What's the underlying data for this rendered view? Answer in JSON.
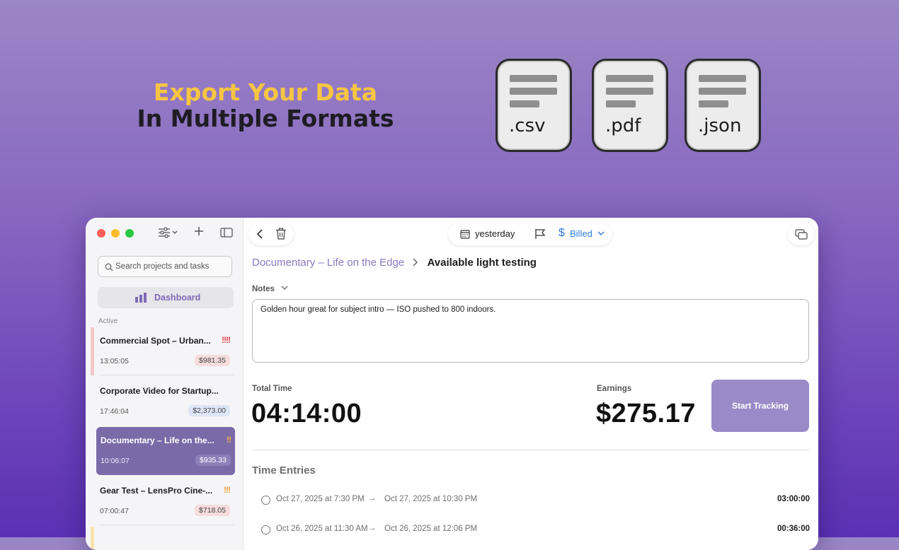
{
  "hero": {
    "line1": "Export Your Data",
    "line2": "In Multiple Formats"
  },
  "files": [
    {
      "ext": ".csv"
    },
    {
      "ext": ".pdf"
    },
    {
      "ext": ".json"
    }
  ],
  "sidebar": {
    "search_placeholder": "Search projects and tasks",
    "dashboard_label": "Dashboard",
    "section_label": "Active",
    "projects": [
      {
        "title": "Commercial Spot – Urban...",
        "priority": "!!!!",
        "time": "13:05:05",
        "amount": "$981.35"
      },
      {
        "title": "Corporate Video for Startup...",
        "priority": "",
        "time": "17:46:04",
        "amount": "$2,373.00"
      },
      {
        "title": "Documentary – Life on the...",
        "priority": "!!",
        "time": "10:06:07",
        "amount": "$935.33"
      },
      {
        "title": "Gear Test – LensPro Cine-...",
        "priority": "!!!",
        "time": "07:00:47",
        "amount": "$718.05"
      }
    ]
  },
  "toolbar": {
    "date_label": "yesterday",
    "billing_label": "Billed"
  },
  "breadcrumb": {
    "project": "Documentary – Life on the Edge",
    "task": "Available light testing"
  },
  "notes": {
    "label": "Notes",
    "text": "Golden hour great for subject intro — ISO pushed to 800 indoors."
  },
  "stats": {
    "total_time_label": "Total Time",
    "total_time": "04:14:00",
    "earnings_label": "Earnings",
    "earnings": "$275.17",
    "start_label": "Start Tracking"
  },
  "entries_title": "Time Entries",
  "entries": [
    {
      "from": "Oct 27, 2025 at 7:30 PM",
      "to": "Oct 27, 2025 at 10:30 PM",
      "duration": "03:00:00"
    },
    {
      "from": "Oct 26, 2025 at 11:30 AM",
      "to": "Oct 26, 2025 at 12:06 PM",
      "duration": "00:36:00"
    }
  ],
  "colors": {
    "accent": "#8a78c0",
    "title_yellow": "#f6c543",
    "selected_row": "#7a6aa8",
    "button": "#9b8ac8"
  }
}
